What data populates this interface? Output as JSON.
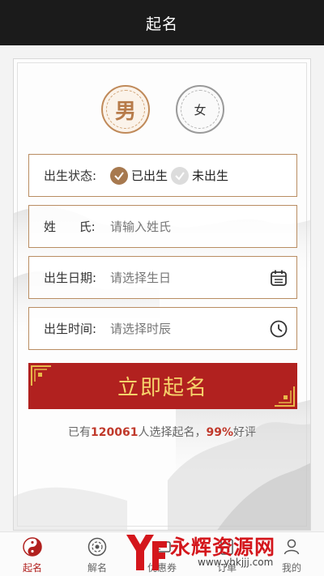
{
  "topbar": {
    "title": "起名"
  },
  "gender": {
    "male": "男",
    "female": "女"
  },
  "form": {
    "status_label": "出生状态:",
    "status_born": "已出生",
    "status_unborn": "未出生",
    "surname_label": "姓      氏:",
    "surname_placeholder": "请输入姓氏",
    "date_label": "出生日期:",
    "date_placeholder": "请选择生日",
    "time_label": "出生时间:",
    "time_placeholder": "请选择时辰"
  },
  "submit_label": "立即起名",
  "stats": {
    "prefix": "已有",
    "count": "120061",
    "middle": "人选择起名，",
    "percent": "99%",
    "suffix": "好评"
  },
  "tabs": [
    {
      "label": "起名",
      "icon": "yin-yang-icon"
    },
    {
      "label": "解名",
      "icon": "bagua-icon"
    },
    {
      "label": "优惠券",
      "icon": "coupon-icon"
    },
    {
      "label": "订单",
      "icon": "order-icon"
    },
    {
      "label": "我的",
      "icon": "user-icon"
    }
  ],
  "watermark": {
    "text": "永辉资源网",
    "url": "www.yhkjjj.com"
  },
  "colors": {
    "accent": "#b1211f",
    "gold": "#f6d36b",
    "brown": "#a7794f",
    "topbar": "#1b1b1b"
  }
}
